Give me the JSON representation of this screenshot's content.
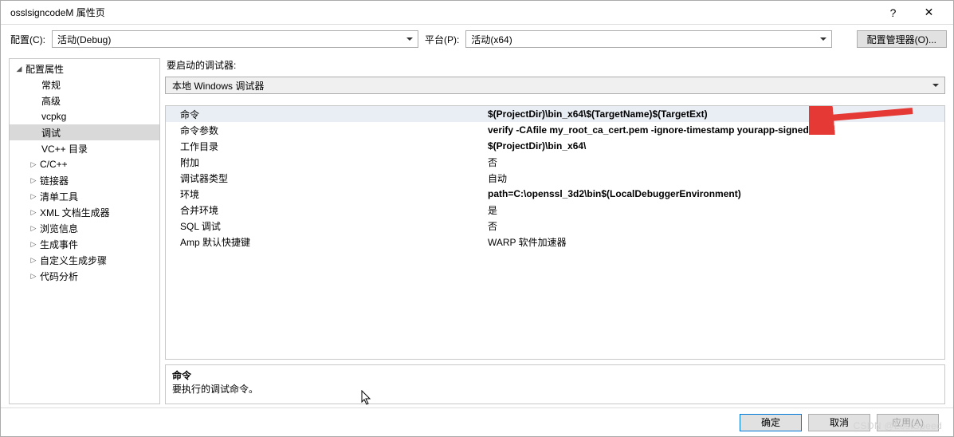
{
  "window": {
    "title": "osslsigncodeM 属性页",
    "help": "?",
    "close": "✕"
  },
  "configrow": {
    "config_label": "配置(C):",
    "config_value": "活动(Debug)",
    "platform_label": "平台(P):",
    "platform_value": "活动(x64)",
    "manager_btn": "配置管理器(O)..."
  },
  "sidebar": {
    "root": "配置属性",
    "items": [
      "常规",
      "高级",
      "vcpkg",
      "调试",
      "VC++ 目录"
    ],
    "expandable": [
      "C/C++",
      "链接器",
      "清单工具",
      "XML 文档生成器",
      "浏览信息",
      "生成事件",
      "自定义生成步骤",
      "代码分析"
    ]
  },
  "content": {
    "label": "要启动的调试器:",
    "debugger": "本地 Windows 调试器",
    "rows": [
      {
        "k": "命令",
        "v": "$(ProjectDir)\\bin_x64\\$(TargetName)$(TargetExt)",
        "bold": true,
        "sel": true
      },
      {
        "k": "命令参数",
        "v": "verify -CAfile my_root_ca_cert.pem -ignore-timestamp yourapp-signed4.exe",
        "bold": true
      },
      {
        "k": "工作目录",
        "v": "$(ProjectDir)\\bin_x64\\",
        "bold": true
      },
      {
        "k": "附加",
        "v": "否",
        "bold": false
      },
      {
        "k": "调试器类型",
        "v": "自动",
        "bold": false
      },
      {
        "k": "环境",
        "v": "path=C:\\openssl_3d2\\bin$(LocalDebuggerEnvironment)",
        "bold": true
      },
      {
        "k": "合并环境",
        "v": "是",
        "bold": false
      },
      {
        "k": "SQL 调试",
        "v": "否",
        "bold": false
      },
      {
        "k": "Amp 默认快捷键",
        "v": "WARP 软件加速器",
        "bold": false
      }
    ],
    "help_title": "命令",
    "help_text": "要执行的调试命令。"
  },
  "footer": {
    "ok": "确定",
    "cancel": "取消",
    "apply": "应用(A)"
  },
  "watermark": "CSDN @LostSpeed"
}
